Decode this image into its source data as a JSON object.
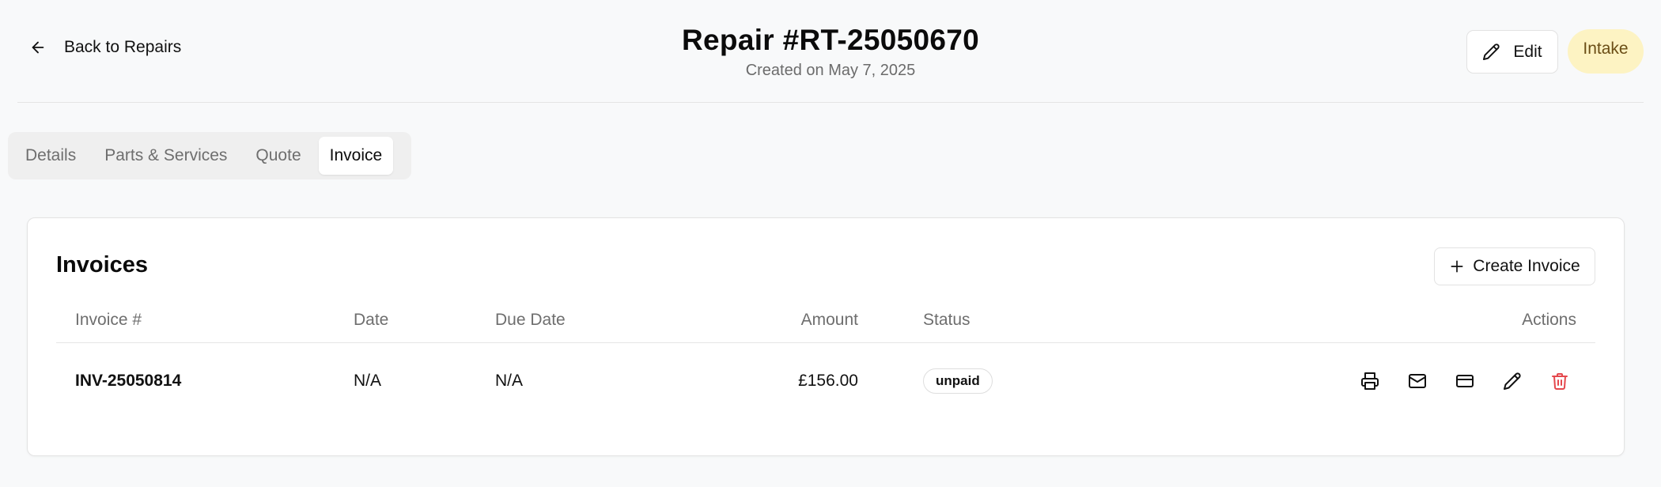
{
  "header": {
    "back_label": "Back to Repairs",
    "title": "Repair #RT-25050670",
    "subtitle": "Created on May 7, 2025",
    "edit_label": "Edit",
    "status": "Intake"
  },
  "tabs": [
    {
      "label": "Details",
      "active": false
    },
    {
      "label": "Parts & Services",
      "active": false
    },
    {
      "label": "Quote",
      "active": false
    },
    {
      "label": "Invoice",
      "active": true
    }
  ],
  "invoices": {
    "title": "Invoices",
    "create_label": "Create Invoice",
    "columns": {
      "invoice": "Invoice #",
      "date": "Date",
      "due_date": "Due Date",
      "amount": "Amount",
      "status": "Status",
      "actions": "Actions"
    },
    "rows": [
      {
        "invoice": "INV-25050814",
        "date": "N/A",
        "due_date": "N/A",
        "amount": "£156.00",
        "status": "unpaid",
        "actions": [
          "printer-icon",
          "mail-icon",
          "credit-card-icon",
          "pencil-icon",
          "trash-icon"
        ]
      }
    ]
  },
  "colors": {
    "status_pill_bg": "#fdf3c3",
    "status_pill_text": "#6b4e16",
    "delete_red": "#e5484d",
    "muted_text": "#6e6e6e"
  }
}
